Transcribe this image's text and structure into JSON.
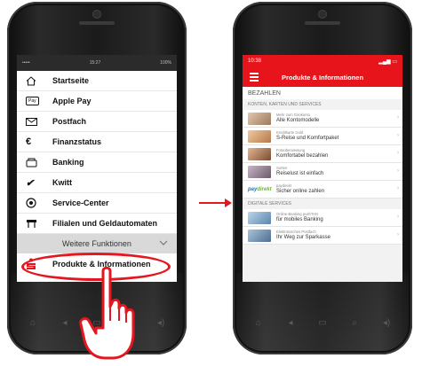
{
  "left_phone": {
    "status": {
      "carrier": "•••••",
      "time": "15:27",
      "battery": "100%"
    },
    "menu": [
      {
        "icon": "home-icon",
        "label": "Startseite"
      },
      {
        "icon": "apple-pay-icon",
        "label": "Apple Pay",
        "icon_text": "Pay"
      },
      {
        "icon": "mail-icon",
        "label": "Postfach"
      },
      {
        "icon": "euro-icon",
        "label": "Finanzstatus"
      },
      {
        "icon": "banking-icon",
        "label": "Banking"
      },
      {
        "icon": "kwitt-icon",
        "label": "Kwitt"
      },
      {
        "icon": "service-center-icon",
        "label": "Service-Center"
      },
      {
        "icon": "atm-icon",
        "label": "Filialen und Geldautomaten"
      }
    ],
    "weitere_funktionen": "Weitere Funktionen",
    "produkte_label": "Produkte & Informationen"
  },
  "right_phone": {
    "status": {
      "time": "10:38"
    },
    "header_title": "Produkte & Informationen",
    "section_bezahlen": "BEZAHLEN",
    "section_konten": "KONTEN, KARTEN UND SERVICES",
    "rows_konten": [
      {
        "sub": "Mehr zum Girokonto",
        "main": "Alle Kontomodelle",
        "thumb": "#c9a58a"
      },
      {
        "sub": "Kreditkarte Gold",
        "main": "S-Reise und Komfortpaket",
        "thumb": "#d8a77d"
      },
      {
        "sub": "Fotoüberweisung",
        "main": "Komfortabel bezahlen",
        "thumb": "#b9835f"
      },
      {
        "sub": "Sorten",
        "main": "Reiselust ist einfach",
        "thumb": "#9a7b8a"
      },
      {
        "sub": "paydirekt",
        "main": "Sicher online zahlen",
        "logo": "paydirekt"
      }
    ],
    "section_digitale": "DIGITALE SERVICES",
    "rows_digitale": [
      {
        "sub": "Online-Banking pushTAN",
        "main": "für mobiles Banking",
        "thumb": "#7fa6c8"
      },
      {
        "sub": "Elektronisches Postfach",
        "main": "Ihr Weg zur Sparkasse",
        "thumb": "#6e8fb0"
      }
    ]
  },
  "colors": {
    "brand_red": "#e8141b",
    "highlight_red": "#e4161f"
  }
}
